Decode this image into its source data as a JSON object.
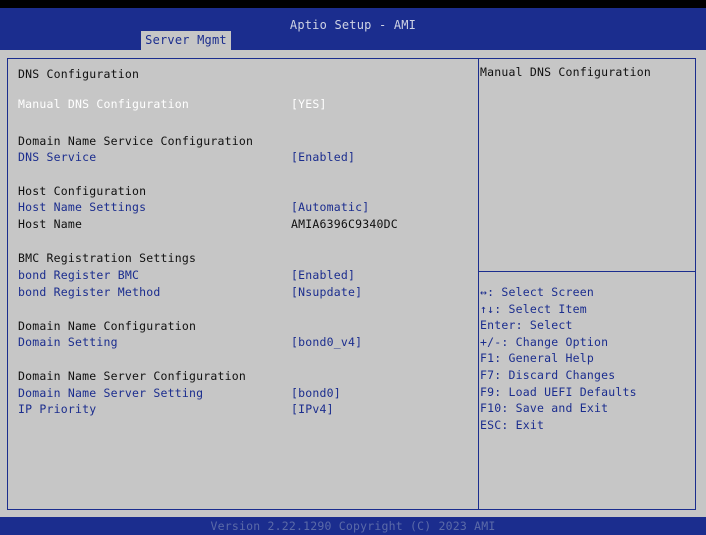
{
  "header": {
    "title": "Aptio Setup - AMI",
    "active_tab": "Server Mgmt"
  },
  "settings": {
    "page_heading": "DNS Configuration",
    "manual_dns": {
      "label": "Manual DNS Configuration",
      "value": "[YES]"
    },
    "domain_service_heading": "Domain Name Service Configuration",
    "dns_service": {
      "label": "DNS Service",
      "value": "[Enabled]"
    },
    "host_heading": "Host Configuration",
    "host_name_settings": {
      "label": "Host Name Settings",
      "value": "[Automatic]"
    },
    "host_name": {
      "label": "Host Name",
      "value": "AMIA6396C9340DC"
    },
    "bmc_heading": "BMC Registration Settings",
    "bond_register_bmc": {
      "label": "bond Register BMC",
      "value": "[Enabled]"
    },
    "bond_register_method": {
      "label": "bond Register Method",
      "value": "[Nsupdate]"
    },
    "domain_name_heading": "Domain Name Configuration",
    "domain_setting": {
      "label": "Domain Setting",
      "value": "[bond0_v4]"
    },
    "dns_server_heading": "Domain Name Server Configuration",
    "dns_server_setting": {
      "label": "Domain Name Server Setting",
      "value": "[bond0]"
    },
    "ip_priority": {
      "label": "IP Priority",
      "value": "[IPv4]"
    }
  },
  "help_text": "Manual DNS Configuration",
  "keys": [
    "↔: Select Screen",
    "↑↓: Select Item",
    "Enter: Select",
    "+/-: Change Option",
    "F1: General Help",
    "F7: Discard Changes",
    "F9: Load UEFI Defaults",
    "F10: Save and Exit",
    "ESC: Exit"
  ],
  "footer": "Version 2.22.1290 Copyright (C) 2023 AMI",
  "colors": {
    "header_blue": "#1b2d8e",
    "panel_gray": "#c6c6c6",
    "selected_text": "#ffffff",
    "link_text": "#1b2d8e"
  }
}
